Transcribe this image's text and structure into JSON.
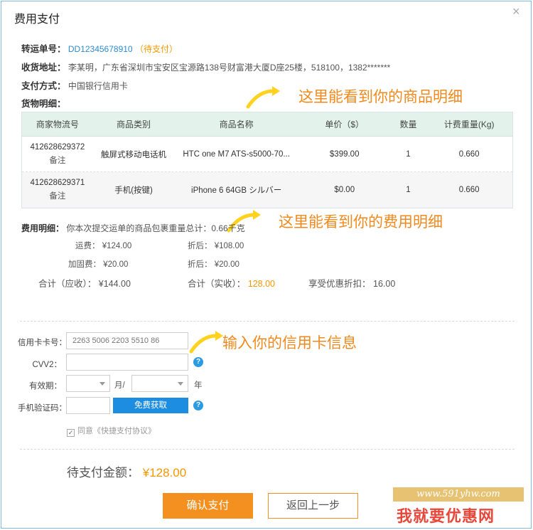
{
  "dialog": {
    "title": "费用支付",
    "close_glyph": "×"
  },
  "order": {
    "transfer_label": "转运单号：",
    "transfer_no": "DD12345678910",
    "transfer_status": "（待支付）",
    "address_label": "收货地址：",
    "address_value": "李某明，广东省深圳市宝安区宝源路138号财富港大厦D座25楼，518100，1382*******",
    "payment_label": "支付方式：",
    "payment_value": "中国银行信用卡",
    "goods_label": "货物明细："
  },
  "annotations": {
    "goods": "这里能看到你的商品明细",
    "fees": "这里能看到你的费用明细",
    "card": "输入你的信用卡信息"
  },
  "goods_table": {
    "headers": [
      "商家物流号",
      "商品类别",
      "商品名称",
      "单价（$）",
      "数量",
      "计费重量(Kg)"
    ],
    "rows": [
      {
        "tracking": "412628629372",
        "note": "备注",
        "category": "触屏式移动电话机",
        "name": "HTC one M7 ATS-s5000-70...",
        "price": "$399.00",
        "qty": "1",
        "weight": "0.660"
      },
      {
        "tracking": "412628629371",
        "note": "备注",
        "category": "手机(按键)",
        "name": "iPhone 6 64GB シルバー",
        "price": "$0.00",
        "qty": "1",
        "weight": "0.660"
      }
    ]
  },
  "fees": {
    "label": "费用明细：",
    "summary": "你本次提交运单的商品包裹重量总计：0.66千克",
    "shipping_label": "运费：",
    "shipping_value": "¥124.00",
    "shipping_discount_label": "折后：",
    "shipping_discount_value": "¥108.00",
    "reinforce_label": "加固费：",
    "reinforce_value": "¥20.00",
    "reinforce_discount_label": "折后：",
    "reinforce_discount_value": "¥20.00",
    "due_label": "合计（应收）：",
    "due_value": "¥144.00",
    "paid_label": "合计（实收）：",
    "paid_value": "128.00",
    "saving_label": "享受优惠折扣：",
    "saving_value": "16.00"
  },
  "card_form": {
    "card_no_label": "信用卡卡号：",
    "card_no_value": "2263  5006 2203 5510 86",
    "cvv_label": "CVV2：",
    "expiry_label": "有效期：",
    "month_unit": "月/",
    "year_unit": "年",
    "sms_label": "手机验证码：",
    "get_code_button": "免费获取",
    "help_glyph": "?",
    "agree_prefix": "同意",
    "agree_link": "《快捷支付协议》",
    "check_glyph": "✓"
  },
  "footer": {
    "total_label": "待支付金额：",
    "total_value": "¥128.00",
    "confirm_button": "确认支付",
    "back_button": "返回上一步"
  },
  "watermark": {
    "url": "www.591yhw.com",
    "site": "我就要优惠网"
  },
  "colors": {
    "accent_orange": "#f39800",
    "link_blue": "#2f8bd0",
    "button_blue": "#1c8de0",
    "table_header_bg": "#e3f3ec"
  }
}
